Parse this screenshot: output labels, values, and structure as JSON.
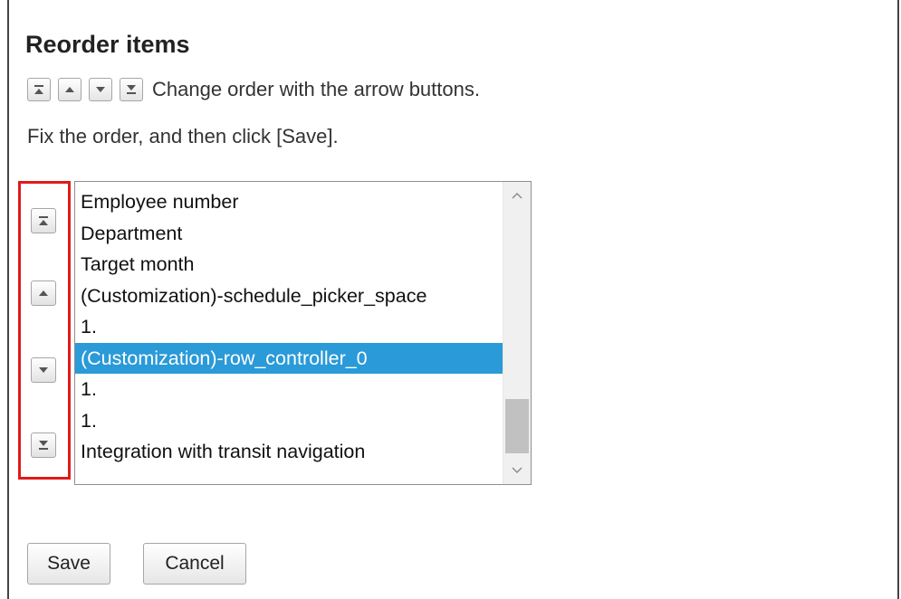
{
  "page": {
    "title": "Reorder items",
    "hint_text": "Change order with the arrow buttons.",
    "instruction": "Fix the order, and then click [Save]."
  },
  "hint_icons": [
    "move-to-top-icon",
    "move-up-icon",
    "move-down-icon",
    "move-to-bottom-icon"
  ],
  "side_controls": [
    "move-to-top-icon",
    "move-up-icon",
    "move-down-icon",
    "move-to-bottom-icon"
  ],
  "list": {
    "items": [
      {
        "label": "Employee number",
        "selected": false
      },
      {
        "label": "Department",
        "selected": false
      },
      {
        "label": "Target month",
        "selected": false
      },
      {
        "label": "(Customization)-schedule_picker_space",
        "selected": false
      },
      {
        "label": "1.",
        "selected": false
      },
      {
        "label": "(Customization)-row_controller_0",
        "selected": true
      },
      {
        "label": "1.",
        "selected": false
      },
      {
        "label": "1.",
        "selected": false
      },
      {
        "label": "Integration with transit navigation",
        "selected": false
      }
    ]
  },
  "buttons": {
    "save": "Save",
    "cancel": "Cancel"
  },
  "colors": {
    "highlight": "#e01a1a",
    "selection": "#2a9ad8"
  }
}
